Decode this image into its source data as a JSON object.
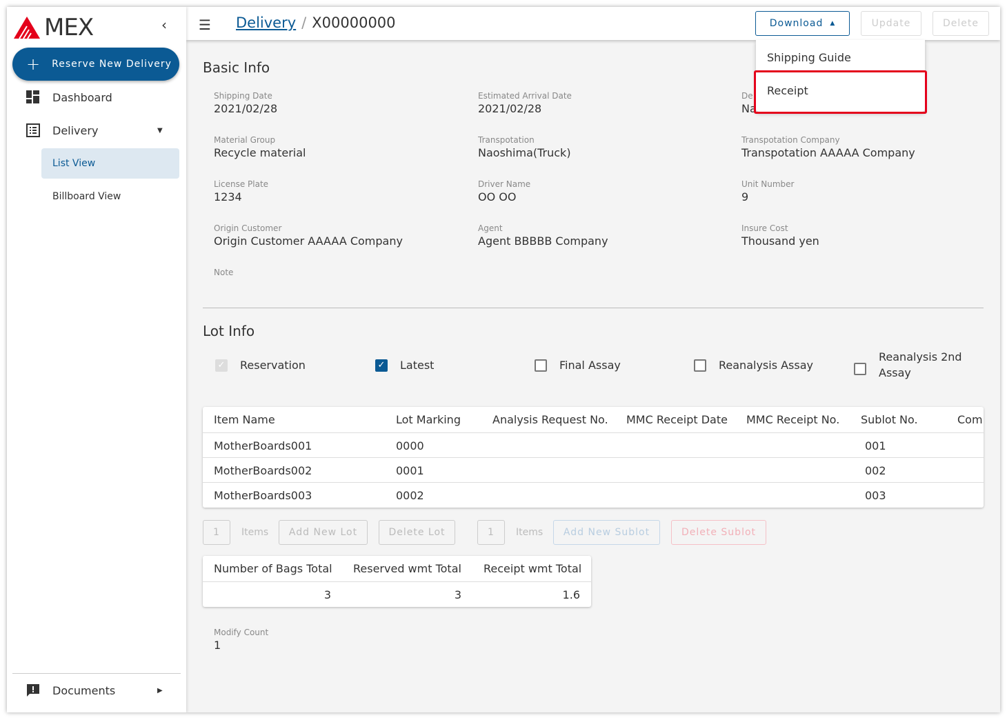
{
  "sidebar": {
    "logo": "MEX",
    "reserve_label": "Reserve New Delivery",
    "items": [
      {
        "label": "Dashboard"
      },
      {
        "label": "Delivery"
      }
    ],
    "sub_items": [
      {
        "label": "List View"
      },
      {
        "label": "Billboard View"
      }
    ],
    "documents": "Documents"
  },
  "header": {
    "breadcrumb_link": "Delivery",
    "breadcrumb_current": "X00000000",
    "download": "Download",
    "update": "Update",
    "delete": "Delete"
  },
  "download_menu": [
    "Shipping Guide",
    "Receipt"
  ],
  "basic": {
    "title": "Basic Info",
    "fields": [
      {
        "k": "Shipping Date",
        "v": "2021/02/28"
      },
      {
        "k": "Estimated Arrival Date",
        "v": "2021/02/28"
      },
      {
        "k": "De",
        "v": "Na"
      },
      {
        "k": "Material Group",
        "v": "Recycle material"
      },
      {
        "k": "Transpotation",
        "v": "Naoshima(Truck)"
      },
      {
        "k": "Transpotation Company",
        "v": "Transpotation AAAAA Company"
      },
      {
        "k": "License Plate",
        "v": "1234"
      },
      {
        "k": "Driver Name",
        "v": "OO OO"
      },
      {
        "k": "Unit Number",
        "v": "9"
      },
      {
        "k": "Origin Customer",
        "v": "Origin Customer AAAAA Company"
      },
      {
        "k": "Agent",
        "v": "Agent BBBBB Company"
      },
      {
        "k": "Insure Cost",
        "v": "Thousand yen"
      },
      {
        "k": "Note",
        "v": ""
      }
    ]
  },
  "lot": {
    "title": "Lot Info",
    "checks": [
      {
        "label": "Reservation"
      },
      {
        "label": "Latest"
      },
      {
        "label": "Final Assay"
      },
      {
        "label": "Reanalysis Assay"
      },
      {
        "label": "Reanalysis 2nd Assay"
      }
    ],
    "columns": [
      "Item Name",
      "Lot Marking",
      "Analysis Request No.",
      "MMC Receipt Date",
      "MMC Receipt No.",
      "Sublot No.",
      "Comi"
    ],
    "rows": [
      [
        "MotherBoards001",
        "0000",
        "",
        "",
        "",
        "001",
        ""
      ],
      [
        "MotherBoards002",
        "0001",
        "",
        "",
        "",
        "002",
        ""
      ],
      [
        "MotherBoards003",
        "0002",
        "",
        "",
        "",
        "003",
        ""
      ]
    ],
    "lot_count": "1",
    "items": "Items",
    "add_lot": "Add New Lot",
    "delete_lot": "Delete Lot",
    "sublot_count": "1",
    "add_sublot": "Add New Sublot",
    "delete_sublot": "Delete Sublot"
  },
  "totals": {
    "columns": [
      "Number of Bags Total",
      "Reserved wmt Total",
      "Receipt wmt Total"
    ],
    "values": [
      "3",
      "3",
      "1.6"
    ]
  },
  "modify": {
    "k": "Modify Count",
    "v": "1"
  }
}
